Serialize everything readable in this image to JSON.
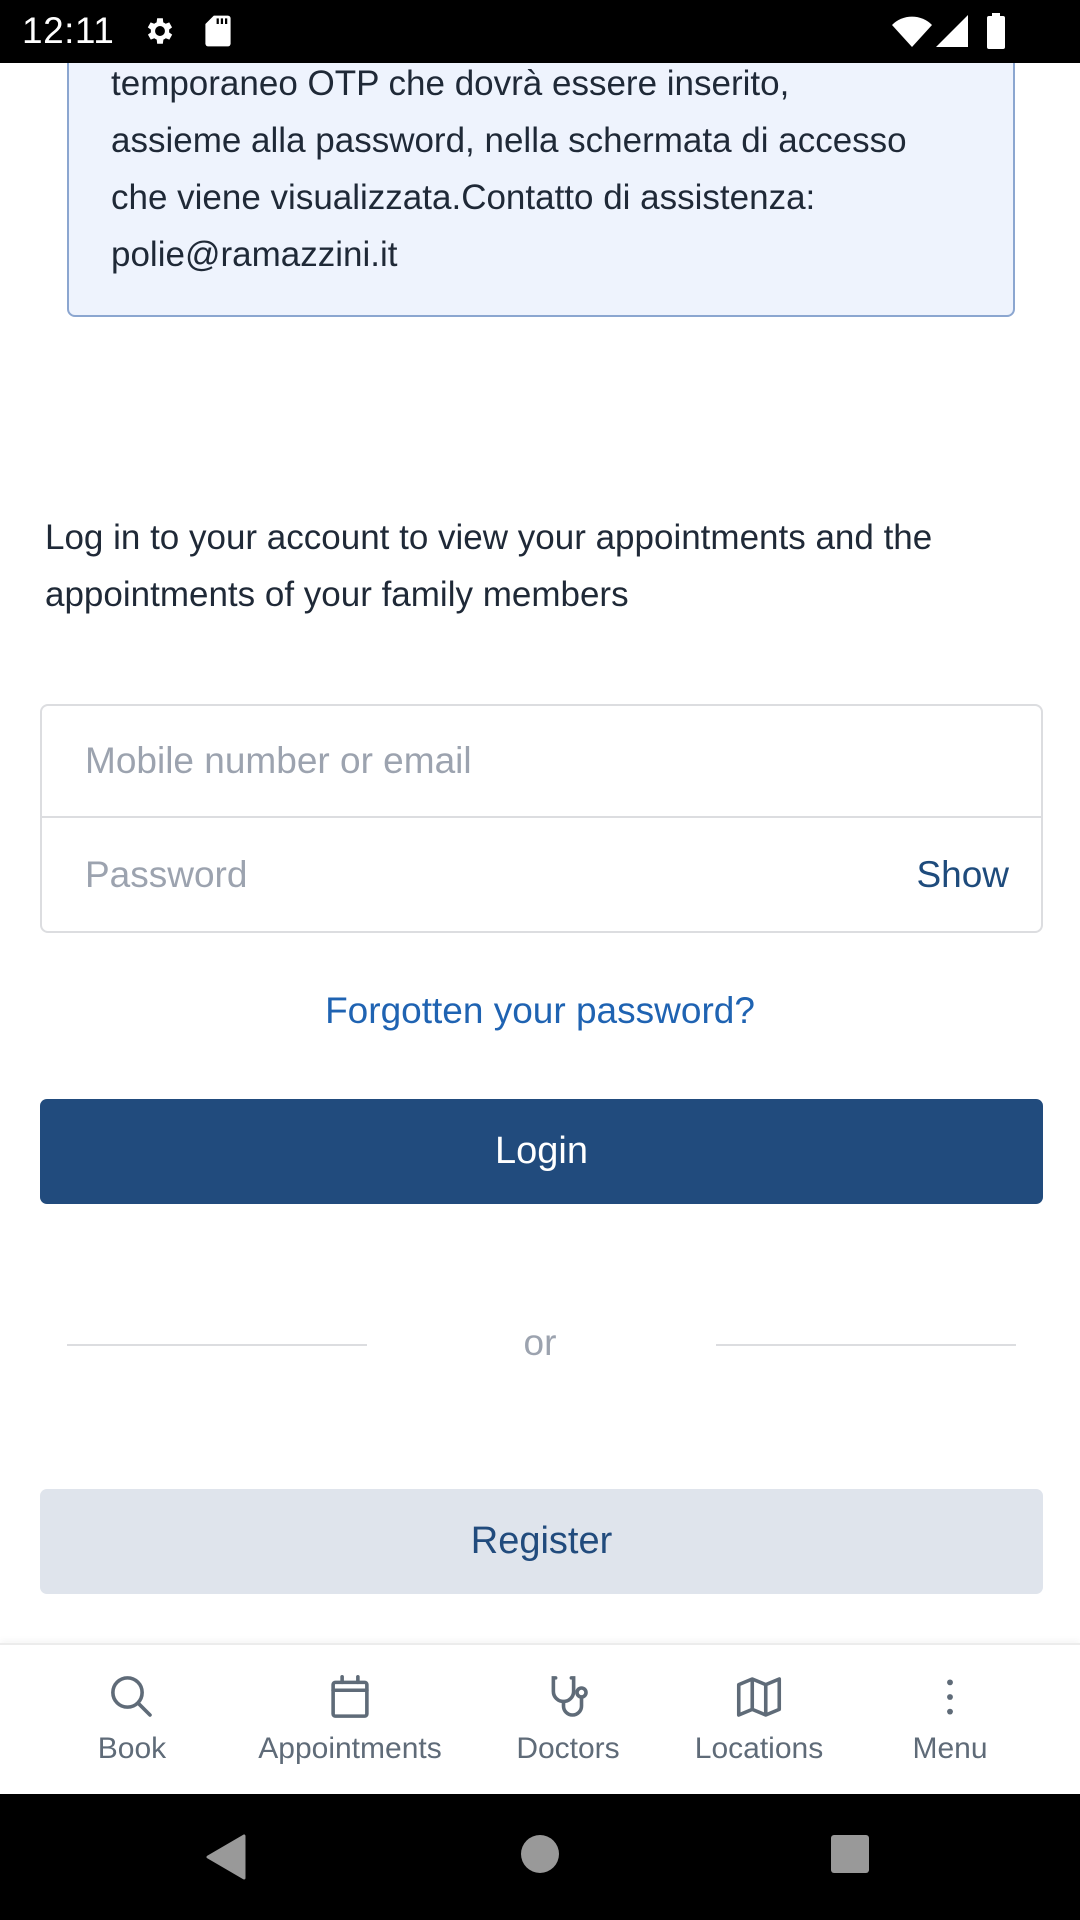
{
  "status_bar": {
    "time": "12:11",
    "icons": [
      "gear-icon",
      "sd-card-icon",
      "wifi-icon",
      "cell-signal-icon",
      "battery-icon"
    ]
  },
  "info_box": {
    "text": "temporaneo OTP che dovrà essere inserito, assieme alla password, nella schermata di accesso che viene visualizzata.Contatto di assistenza: polie@ramazzini.it"
  },
  "login": {
    "intro": "Log in to your account to view your appointments and the appointments of your family members",
    "email_placeholder": "Mobile number or email",
    "email_value": "",
    "password_placeholder": "Password",
    "password_value": "",
    "show_label": "Show",
    "forgot_label": "Forgotten your password?",
    "login_label": "Login",
    "or_label": "or",
    "register_label": "Register"
  },
  "bottom_nav": {
    "items": [
      {
        "label": "Book",
        "icon": "search-icon"
      },
      {
        "label": "Appointments",
        "icon": "calendar-icon"
      },
      {
        "label": "Doctors",
        "icon": "stethoscope-icon"
      },
      {
        "label": "Locations",
        "icon": "map-icon"
      },
      {
        "label": "Menu",
        "icon": "more-vertical-icon"
      }
    ]
  },
  "system_nav": {
    "buttons": [
      "back",
      "home",
      "recents"
    ]
  },
  "colors": {
    "primary": "#214b7d",
    "link": "#1f63b2",
    "info_bg": "#eef3fd",
    "info_border": "#8ba6d0",
    "secondary_bg": "#dfe4ec",
    "nav_gray": "#5f6b78"
  }
}
